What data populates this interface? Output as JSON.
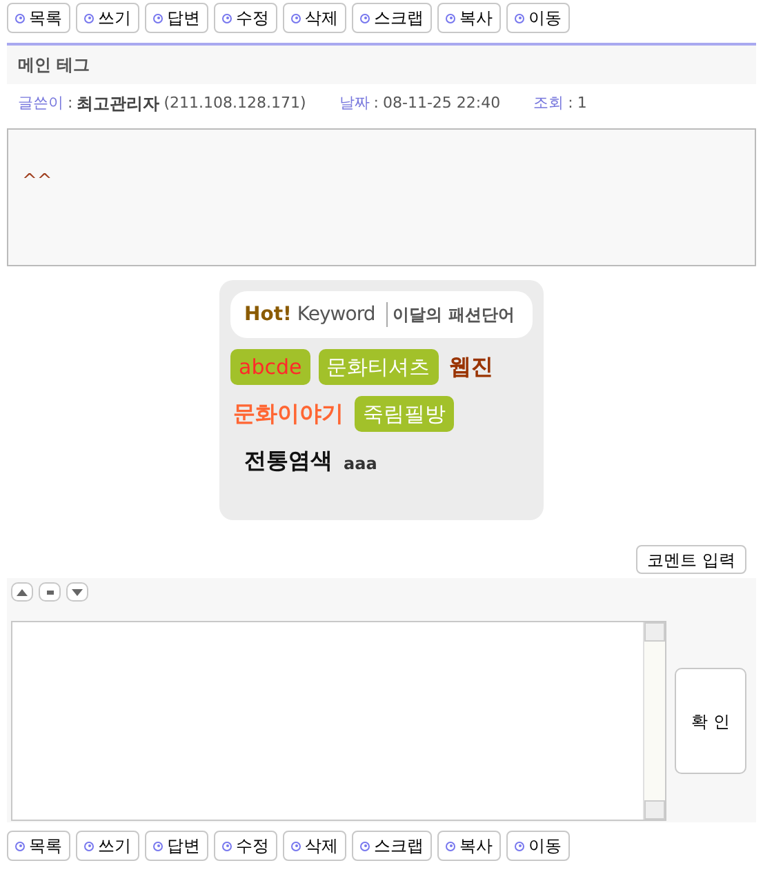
{
  "toolbar_top": [
    "목록",
    "쓰기",
    "답변",
    "수정",
    "삭제",
    "스크랩",
    "복사",
    "이동"
  ],
  "post": {
    "title": "메인 테그",
    "separator": ":",
    "author_label": "글쓴이",
    "author": "최고관리자",
    "ip": "(211.108.128.171)",
    "date_label": "날짜",
    "date": "08-11-25 22:40",
    "views_label": "조회",
    "views": "1",
    "body": "^^"
  },
  "hot_keyword": {
    "hot": "Hot!",
    "keyword": "Keyword",
    "subtitle": "이달의 패션단어",
    "rows": [
      [
        {
          "text": "abcde",
          "kind": "badge",
          "color": "#ff2a2a"
        },
        {
          "text": "문화티셔츠",
          "kind": "badge",
          "color": "#ffffff"
        },
        {
          "text": "웹진",
          "kind": "plain",
          "color": "#993300"
        }
      ],
      [
        {
          "text": "문화이야기",
          "kind": "plain",
          "color": "#ff6633"
        },
        {
          "text": "죽림필방",
          "kind": "badge",
          "color": "#ffffff"
        }
      ],
      [
        {
          "text": "전통염색",
          "kind": "plain",
          "color": "#111111"
        },
        {
          "text": "aaa",
          "kind": "small",
          "color": "#333333"
        }
      ]
    ]
  },
  "comment": {
    "toggle_button": "코멘트 입력",
    "submit_button": "확 인"
  },
  "toolbar_bottom": [
    "목록",
    "쓰기",
    "답변",
    "수정",
    "삭제",
    "스크랩",
    "복사",
    "이동"
  ]
}
